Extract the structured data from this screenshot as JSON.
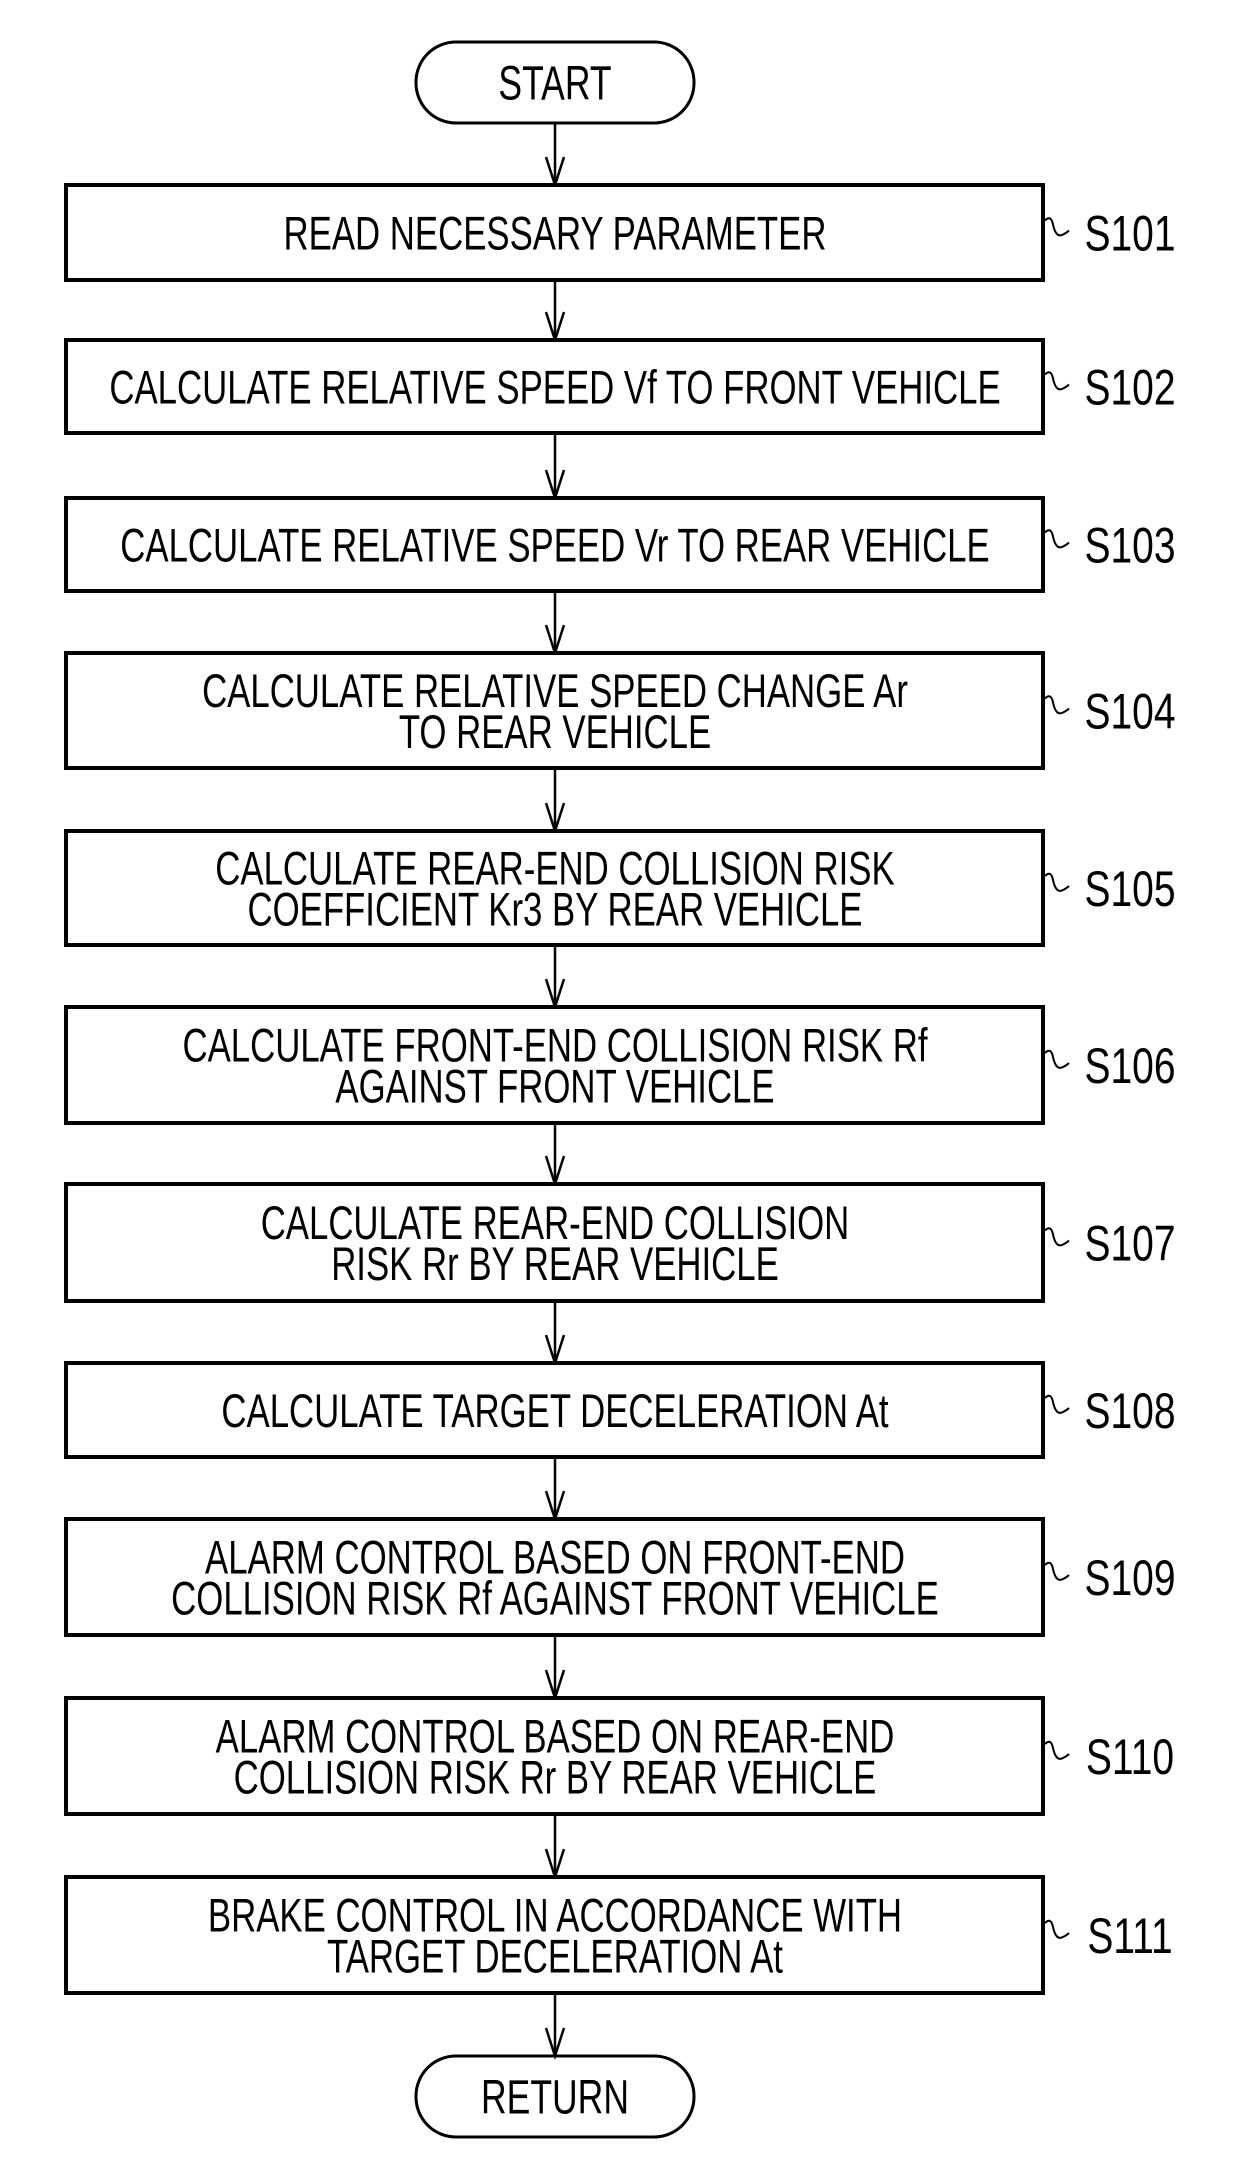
{
  "flowchart": {
    "start": {
      "label": "START"
    },
    "end": {
      "label": "RETURN"
    },
    "steps": [
      {
        "id": "S101",
        "lines": [
          "READ NECESSARY PARAMETER"
        ]
      },
      {
        "id": "S102",
        "lines": [
          "CALCULATE RELATIVE SPEED Vf TO FRONT VEHICLE"
        ]
      },
      {
        "id": "S103",
        "lines": [
          "CALCULATE RELATIVE SPEED Vr TO REAR VEHICLE"
        ]
      },
      {
        "id": "S104",
        "lines": [
          "CALCULATE RELATIVE SPEED CHANGE Ar",
          "TO REAR VEHICLE"
        ]
      },
      {
        "id": "S105",
        "lines": [
          "CALCULATE REAR-END COLLISION RISK",
          "COEFFICIENT Kr3 BY REAR VEHICLE"
        ]
      },
      {
        "id": "S106",
        "lines": [
          "CALCULATE FRONT-END COLLISION RISK Rf",
          "AGAINST FRONT VEHICLE"
        ]
      },
      {
        "id": "S107",
        "lines": [
          "CALCULATE REAR-END COLLISION",
          "RISK Rr BY REAR VEHICLE"
        ]
      },
      {
        "id": "S108",
        "lines": [
          "CALCULATE TARGET DECELERATION At"
        ]
      },
      {
        "id": "S109",
        "lines": [
          "ALARM CONTROL BASED ON FRONT-END",
          "COLLISION RISK Rf AGAINST FRONT VEHICLE"
        ]
      },
      {
        "id": "S110",
        "lines": [
          "ALARM CONTROL BASED ON REAR-END",
          "COLLISION RISK Rr BY REAR VEHICLE"
        ]
      },
      {
        "id": "S111",
        "lines": [
          "BRAKE CONTROL IN ACCORDANCE WITH",
          "TARGET DECELERATION At"
        ]
      }
    ]
  }
}
